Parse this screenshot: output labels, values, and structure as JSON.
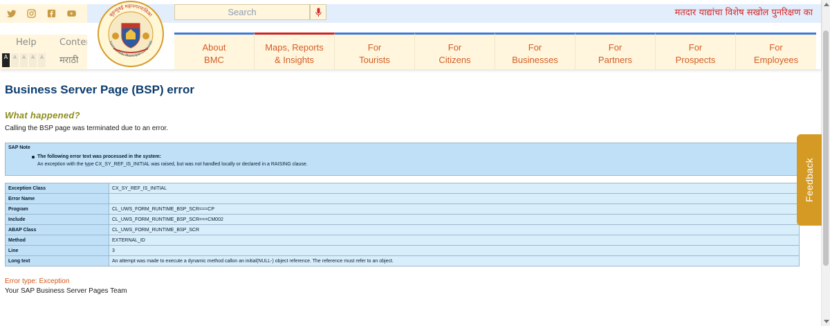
{
  "header": {
    "social": [
      {
        "name": "twitter-icon"
      },
      {
        "name": "instagram-icon"
      },
      {
        "name": "facebook-icon"
      },
      {
        "name": "youtube-icon"
      }
    ],
    "search": {
      "placeholder": "Search"
    },
    "announcement": "मतदार याद्यांचा विशेष सखोल पुनरिक्षण का",
    "help_label": "Help",
    "content_label": "Conten",
    "marathi_label": "मराठी",
    "font_size_buttons": [
      "A",
      "A",
      "A",
      "A",
      "A"
    ],
    "logo": {
      "arc_text": "बृहन्मुंबई महानगरपालिका",
      "bottom_text": "Brihanmumbai Municipal Corporation"
    }
  },
  "nav": [
    {
      "label": "About\nBMC"
    },
    {
      "label": "Maps, Reports\n& Insights"
    },
    {
      "label": "For\nTourists"
    },
    {
      "label": "For\nCitizens"
    },
    {
      "label": "For\nBusinesses"
    },
    {
      "label": "For\nPartners"
    },
    {
      "label": "For\nProspects"
    },
    {
      "label": "For\nEmployees"
    }
  ],
  "content": {
    "title": "Business Server Page (BSP) error",
    "what_heading": "What happened?",
    "what_text": "Calling the BSP page was terminated due to an error.",
    "note": {
      "title": "SAP Note",
      "lead": "The following error text was processed in the system:",
      "detail": "An exception with the type CX_SY_REF_IS_INITIAL was raised, but was not handled locally or declared in a RAISING clause."
    },
    "rows": [
      {
        "key": "Exception Class",
        "value": "CX_SY_REF_IS_INITIAL"
      },
      {
        "key": "Error Name",
        "value": ""
      },
      {
        "key": "Program",
        "value": "CL_UWS_FORM_RUNTIME_BSP_SCR===CP"
      },
      {
        "key": "Include",
        "value": "CL_UWS_FORM_RUNTIME_BSP_SCR===CM002"
      },
      {
        "key": "ABAP Class",
        "value": "CL_UWS_FORM_RUNTIME_BSP_SCR"
      },
      {
        "key": "Method",
        "value": "EXTERNAL_ID"
      },
      {
        "key": "Line",
        "value": "3"
      },
      {
        "key": "Long text",
        "value": "An attempt was made to execute a dynamic method callon an initial(NULL-) object reference. The reference must refer to an object."
      }
    ],
    "error_type": "Error type: Exception",
    "team": "Your SAP Business Server Pages Team"
  },
  "feedback_label": "Feedback",
  "colors": {
    "nav_text": "#d35c23",
    "nav_border_blue": "#3d78d8",
    "nav_border_red": "#cc2222",
    "title": "#0b3c6e",
    "what_heading": "#8c8c1a",
    "error_type": "#d2571a",
    "feedback_bg": "#d49a24",
    "panel_bg": "#fff6dd",
    "table_key_bg": "#bfe0f7",
    "table_val_bg": "#d8eefb"
  }
}
